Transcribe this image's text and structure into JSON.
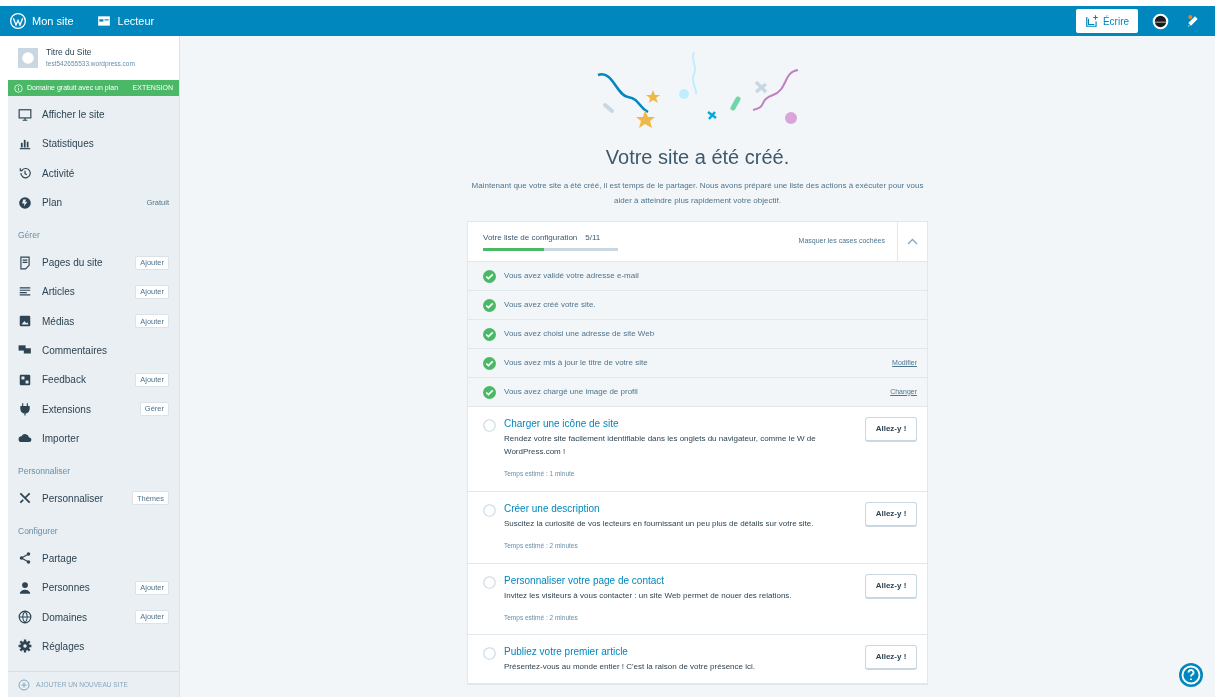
{
  "masthead": {
    "my_site": "Mon site",
    "reader": "Lecteur",
    "write": "Écrire"
  },
  "sidebar": {
    "site": {
      "title": "Titre du Site",
      "url": "test542655533.wordpress.com"
    },
    "notice": {
      "text": "Domaine gratuit avec un plan",
      "action": "EXTENSION"
    },
    "groups": [
      {
        "items": [
          {
            "label": "Afficher le site"
          },
          {
            "label": "Statistiques"
          },
          {
            "label": "Activité"
          },
          {
            "label": "Plan",
            "badge": "Gratuit"
          }
        ]
      },
      {
        "heading": "Gérer",
        "items": [
          {
            "label": "Pages du site",
            "button": "Ajouter"
          },
          {
            "label": "Articles",
            "button": "Ajouter"
          },
          {
            "label": "Médias",
            "button": "Ajouter"
          },
          {
            "label": "Commentaires"
          },
          {
            "label": "Feedback",
            "button": "Ajouter"
          },
          {
            "label": "Extensions",
            "button": "Gérer"
          },
          {
            "label": "Importer"
          }
        ]
      },
      {
        "heading": "Personnaliser",
        "items": [
          {
            "label": "Personnaliser",
            "button": "Thèmes"
          }
        ]
      },
      {
        "heading": "Configurer",
        "items": [
          {
            "label": "Partage"
          },
          {
            "label": "Personnes",
            "button": "Ajouter"
          },
          {
            "label": "Domaines",
            "button": "Ajouter"
          },
          {
            "label": "Réglages"
          }
        ]
      }
    ],
    "add_site": "AJOUTER UN NOUVEAU SITE"
  },
  "hero": {
    "title": "Votre site a été créé.",
    "subtitle": "Maintenant que votre site a été créé, il est temps de le partager. Nous avons préparé une liste des actions à exécuter pour vous aider à atteindre plus rapidement votre objectif."
  },
  "checklist": {
    "title": "Votre liste de configuration",
    "count": "5/11",
    "level": 0.4545,
    "hide_label": "Masquer les cases cochées",
    "expanded": true,
    "items": [
      {
        "label": "Vous avez validé votre adresse e-mail",
        "checked": true
      },
      {
        "label": "Vous avez créé votre site.",
        "checked": true
      },
      {
        "label": "Vous avez choisi une adresse de site Web",
        "checked": true
      },
      {
        "label": "Vous avez mis à jour le titre de votre site",
        "checked": true,
        "action": "Modifier"
      },
      {
        "label": "Vous avez chargé une image de profil",
        "checked": true,
        "action": "Changer"
      },
      {
        "label": "Charger une icône de site",
        "checked": false,
        "description": "Rendez votre site facilement identifiable dans les onglets du navigateur, comme le W de WordPress.com !",
        "estimate": "Temps estimé : 1 minute",
        "button": "Allez-y !"
      },
      {
        "label": "Créer une description",
        "checked": false,
        "description": "Suscitez la curiosité de vos lecteurs en fournissant un peu plus de détails sur votre site.",
        "estimate": "Temps estimé : 2 minutes",
        "button": "Allez-y !"
      },
      {
        "label": "Personnaliser votre page de contact",
        "checked": false,
        "description": "Invitez les visiteurs à vous contacter : un site Web permet de nouer des relations.",
        "estimate": "Temps estimé : 2 minutes",
        "button": "Allez-y !"
      },
      {
        "label": "Publiez votre premier article",
        "checked": false,
        "description": "Présentez-vous au monde entier ! C'est la raison de votre présence ici.",
        "button": "Allez-y !"
      }
    ]
  }
}
